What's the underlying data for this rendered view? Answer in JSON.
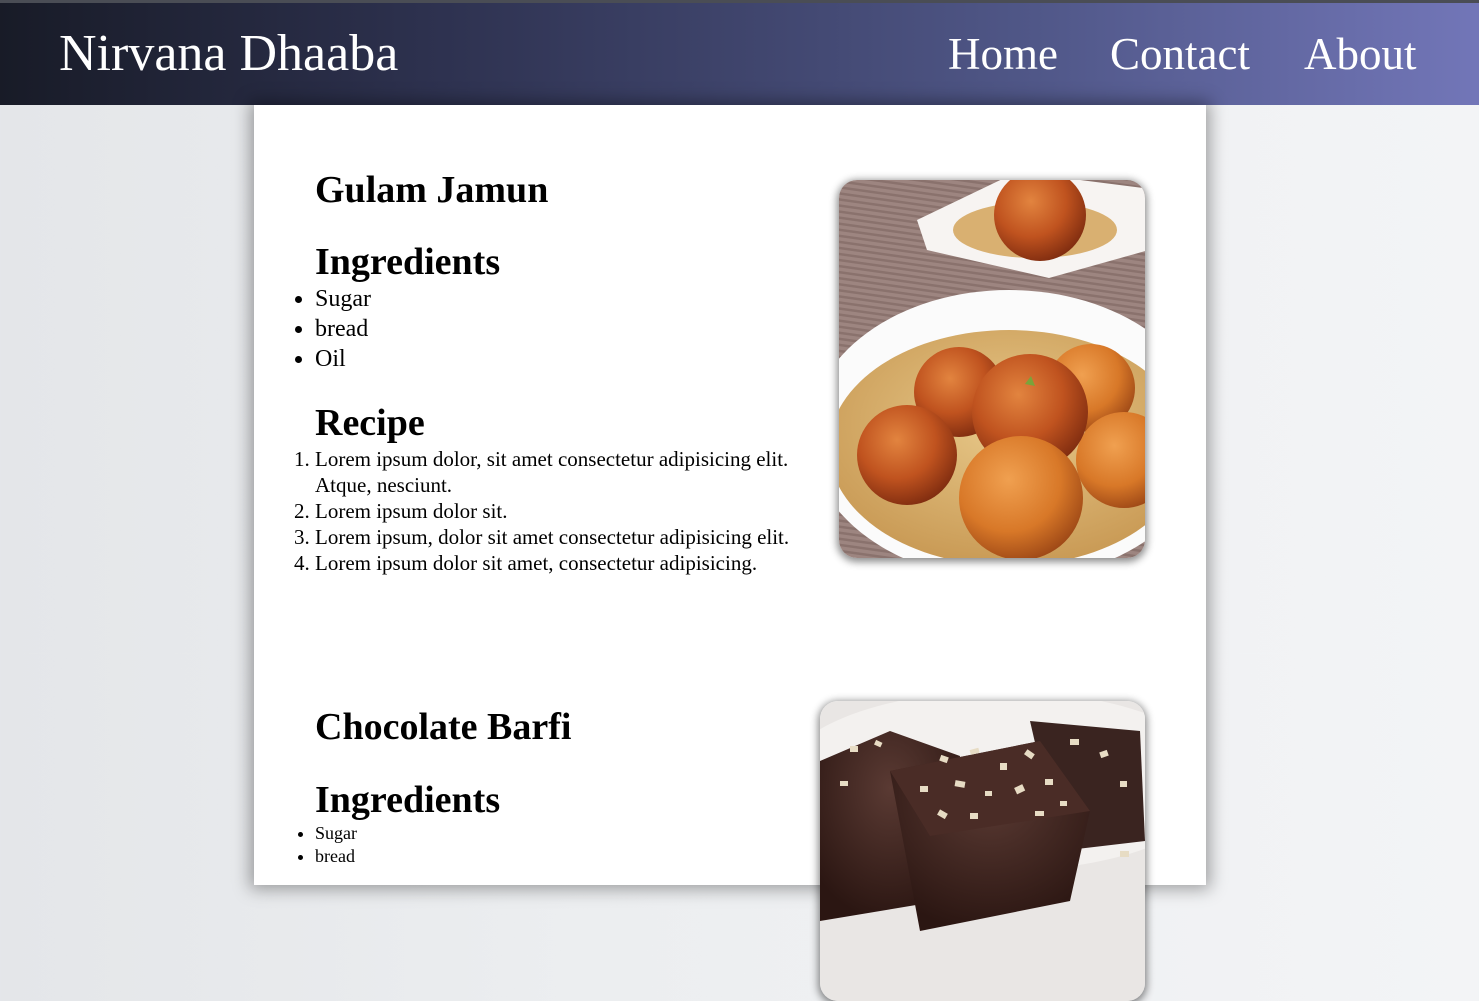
{
  "header": {
    "brand": "Nirvana Dhaaba",
    "nav": [
      {
        "label": "Home"
      },
      {
        "label": "Contact"
      },
      {
        "label": "About"
      }
    ]
  },
  "dishes": [
    {
      "name": "Gulam Jamun",
      "ingredients_heading": "Ingredients",
      "ingredients": [
        "Sugar",
        "bread",
        "Oil"
      ],
      "recipe_heading": "Recipe",
      "recipe": [
        "Lorem ipsum dolor, sit amet consectetur adipisicing elit. Atque, nesciunt.",
        "Lorem ipsum dolor sit.",
        "Lorem ipsum, dolor sit amet consectetur adipisicing elit.",
        "Lorem ipsum dolor sit amet, consectetur adipisicing."
      ]
    },
    {
      "name": "Chocolate Barfi",
      "ingredients_heading": "Ingredients",
      "ingredients": [
        "Sugar",
        "bread"
      ]
    }
  ]
}
